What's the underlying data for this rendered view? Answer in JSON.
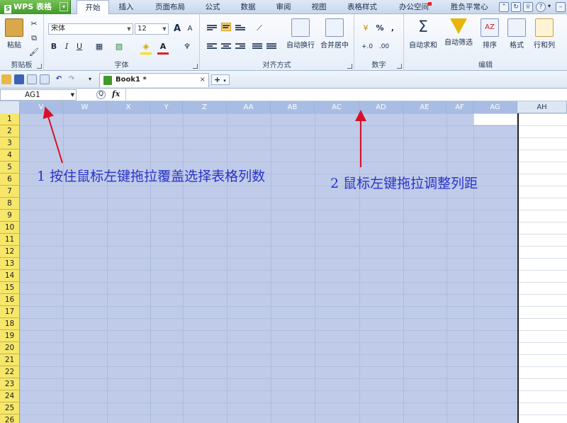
{
  "app": {
    "title": "WPS 表格",
    "logo_letter": "S"
  },
  "ribbon_tabs": [
    {
      "label": "开始",
      "active": true
    },
    {
      "label": "插入"
    },
    {
      "label": "页面布局"
    },
    {
      "label": "公式"
    },
    {
      "label": "数据"
    },
    {
      "label": "审阅"
    },
    {
      "label": "视图"
    },
    {
      "label": "表格样式"
    },
    {
      "label": "办公空间"
    }
  ],
  "user": {
    "name": "胜负平常心"
  },
  "ribbon": {
    "clipboard": {
      "paste": "粘贴",
      "group": "剪贴板"
    },
    "font": {
      "name": "宋体",
      "size": "12",
      "bold": "B",
      "italic": "I",
      "underline": "U",
      "grow": "A",
      "shrink": "A",
      "group": "字体"
    },
    "align": {
      "wrap": "自动换行",
      "merge": "合并居中",
      "group": "对齐方式"
    },
    "number": {
      "percent": "%",
      "comma": ",",
      "group": "数字"
    },
    "editing": {
      "autosum": "自动求和",
      "filter": "自动筛选",
      "sort": "排序",
      "format": "格式",
      "rowcol": "行和列",
      "group": "编辑"
    }
  },
  "document_tab": {
    "name": "Book1 *",
    "close": "×",
    "new": "+"
  },
  "formula_bar": {
    "name_box": "AG1",
    "fx": "fx",
    "zoom_icon": "Q",
    "value": ""
  },
  "columns": [
    "V",
    "W",
    "X",
    "Y",
    "Z",
    "AA",
    "AB",
    "AC",
    "AD",
    "AE",
    "AF",
    "AG",
    "AH"
  ],
  "rows": [
    "1",
    "2",
    "3",
    "4",
    "5",
    "6",
    "7",
    "8",
    "9",
    "10",
    "11",
    "12",
    "13",
    "14",
    "15",
    "16",
    "17",
    "18",
    "19",
    "20",
    "21",
    "22",
    "23",
    "24",
    "25",
    "26"
  ],
  "annotations": {
    "step1": "1 按住鼠标左键拖拉覆盖选择表格列数",
    "step2": "2 鼠标左键拖拉调整列距"
  },
  "colors": {
    "selection": "#bfcbe8",
    "annotation": "#2a33c9",
    "arrow": "#d8102a",
    "row_header": "#f6e76a"
  }
}
